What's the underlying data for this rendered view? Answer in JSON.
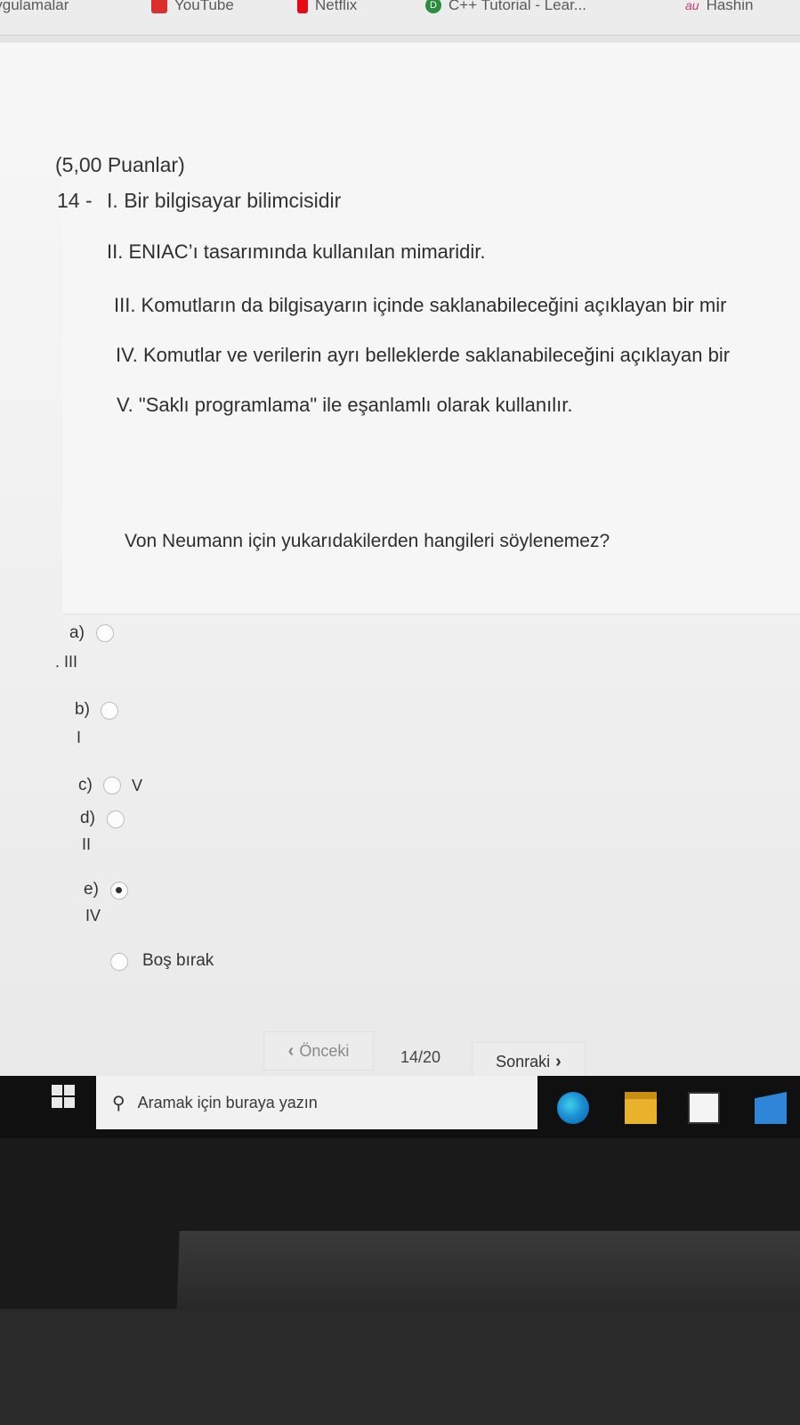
{
  "browser": {
    "bookmarks": [
      {
        "label": "Uygulamalar",
        "icon": "apps-grid-icon"
      },
      {
        "label": "YouTube",
        "icon": "youtube-icon"
      },
      {
        "label": "Netflix",
        "icon": "netflix-icon"
      },
      {
        "label": "C++ Tutorial - Lear...",
        "icon": "tutorial-site-icon"
      },
      {
        "label": "Hashin",
        "icon": "au-site-icon"
      }
    ]
  },
  "quiz": {
    "points": "(5,00 Puanlar)",
    "question_number": "14 -",
    "statements": [
      "I. Bir bilgisayar bilimcisidir",
      "II. ENIAC’ı tasarımında kullanılan mimaridir.",
      "III. Komutların da bilgisayarın içinde saklanabileceğini açıklayan bir mir",
      "IV. Komutlar ve verilerin ayrı belleklerde saklanabileceğini açıklayan bir",
      "V. \"Saklı programlama\" ile eşanlamlı olarak kullanılır."
    ],
    "question_text": "Von Neumann için yukarıdakilerden hangileri söylenemez?",
    "options": [
      {
        "letter": "a)",
        "value": ". III",
        "selected": false
      },
      {
        "letter": "b)",
        "value": "I",
        "selected": false
      },
      {
        "letter": "c)",
        "value": "V",
        "selected": false
      },
      {
        "letter": "d)",
        "value": "II",
        "selected": false
      },
      {
        "letter": "e)",
        "value": "IV",
        "selected": true
      }
    ],
    "skip_label": "Boş bırak",
    "nav": {
      "prev_label": "Önceki",
      "pager": "14/20",
      "next_label": "Sonraki"
    }
  },
  "taskbar": {
    "search_placeholder": "Aramak için buraya yazın"
  }
}
